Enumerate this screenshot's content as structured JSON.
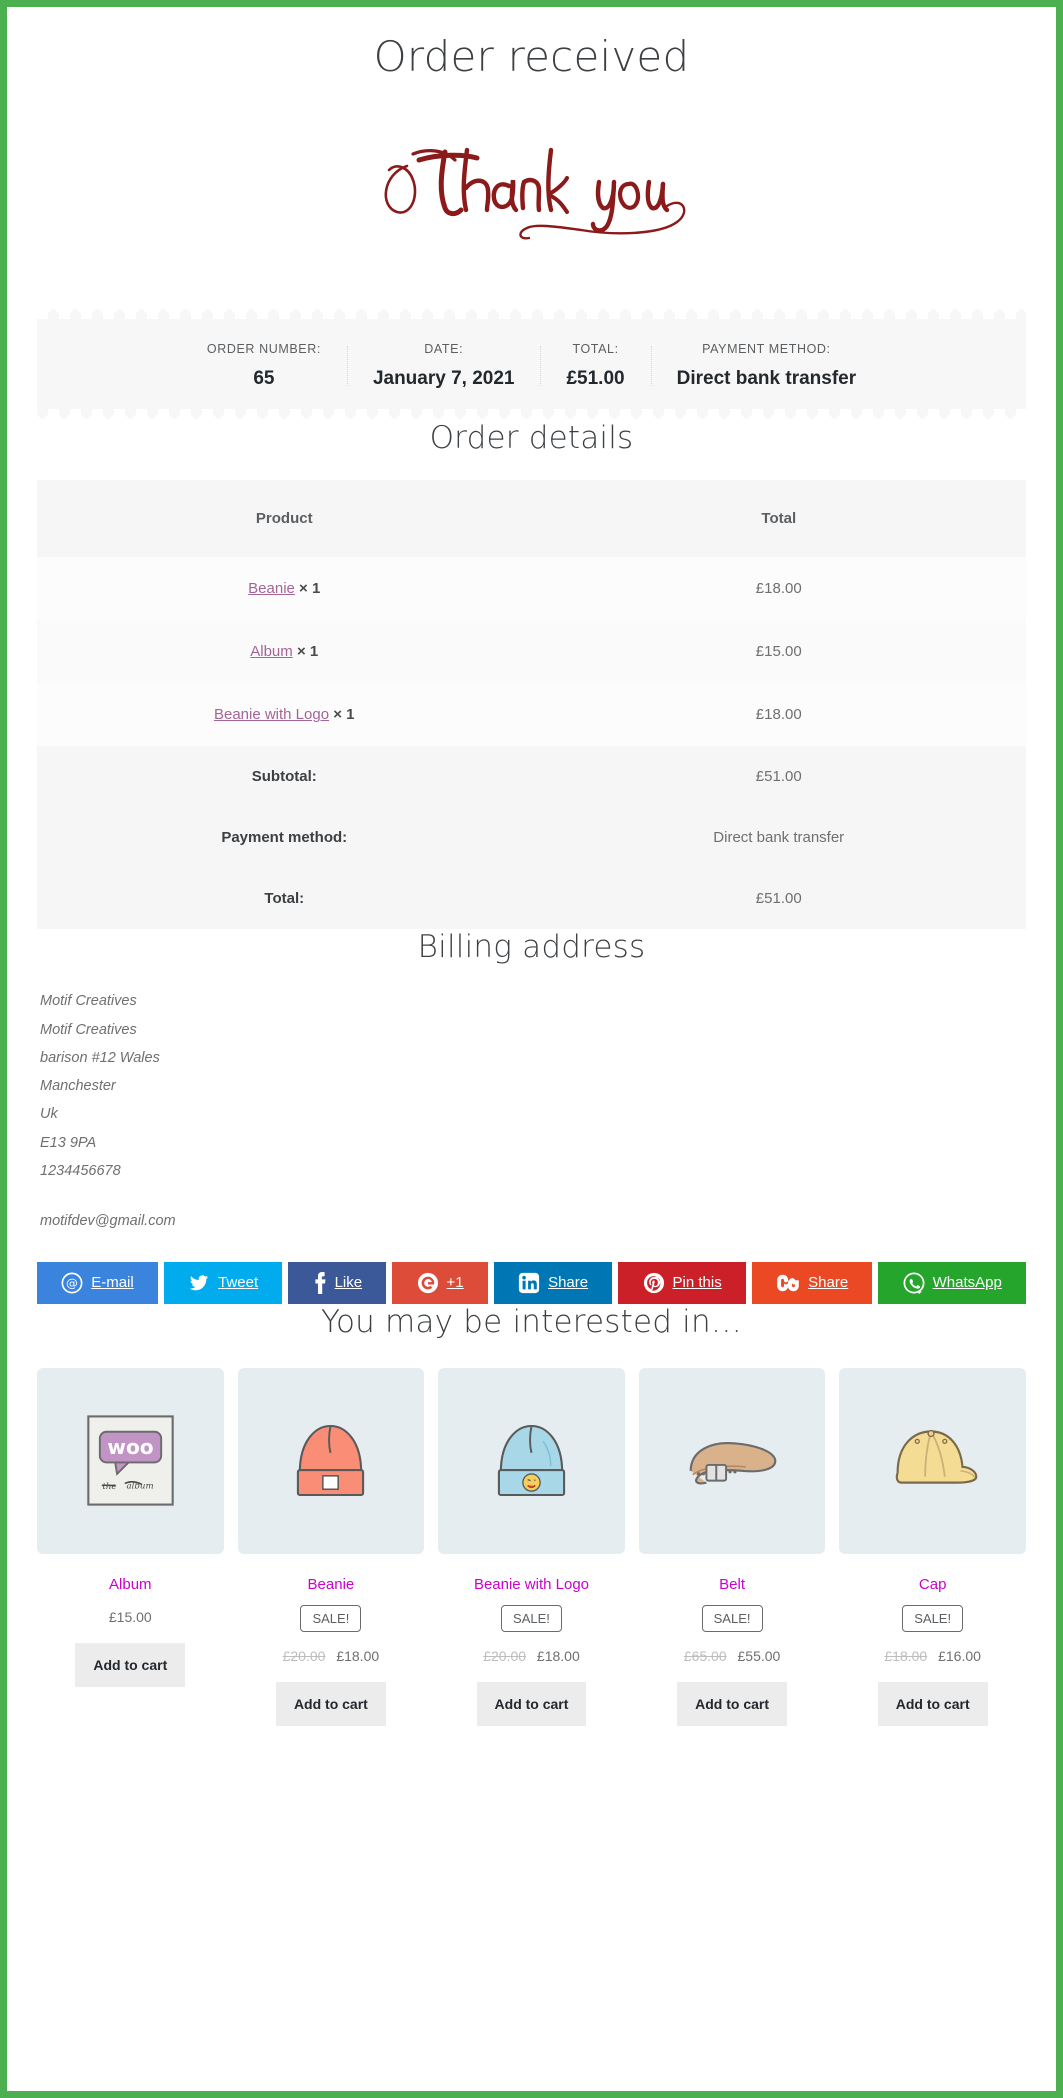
{
  "theme": {
    "admin_bar_color": "#4cb050",
    "link_color": "#a46497",
    "product_link_color": "#cc01cc",
    "script_color": "#8b1a1a"
  },
  "header": {
    "page_title": "Order received",
    "thank_you_script": "Thank you"
  },
  "receipt": {
    "cells": [
      {
        "label": "ORDER NUMBER:",
        "value": "65"
      },
      {
        "label": "DATE:",
        "value": "January 7, 2021"
      },
      {
        "label": "TOTAL:",
        "value": "£51.00"
      },
      {
        "label": "PAYMENT METHOD:",
        "value": "Direct bank transfer"
      }
    ]
  },
  "order_details": {
    "heading": "Order details",
    "columns": [
      "Product",
      "Total"
    ],
    "items": [
      {
        "name": "Beanie",
        "qty": "× 1",
        "total": "£18.00"
      },
      {
        "name": "Album",
        "qty": "× 1",
        "total": "£15.00"
      },
      {
        "name": "Beanie with Logo",
        "qty": "× 1",
        "total": "£18.00"
      }
    ],
    "footer": [
      {
        "label": "Subtotal:",
        "value": "£51.00"
      },
      {
        "label": "Payment method:",
        "value": "Direct bank transfer"
      },
      {
        "label": "Total:",
        "value": "£51.00"
      }
    ]
  },
  "billing": {
    "heading": "Billing address",
    "lines": [
      "Motif Creatives",
      "Motif Creatives",
      "barison #12 Wales",
      "Manchester",
      "Uk",
      "E13 9PA",
      "1234456678"
    ],
    "email": "motifdev@gmail.com"
  },
  "share": {
    "buttons": [
      {
        "icon": "email-icon",
        "label": "E-mail",
        "color": "#3a84dd"
      },
      {
        "icon": "twitter-icon",
        "label": "Tweet",
        "color": "#00aced"
      },
      {
        "icon": "facebook-icon",
        "label": "Like",
        "color": "#3b5998"
      },
      {
        "icon": "google-plus-icon",
        "label": "+1",
        "color": "#dd4b39"
      },
      {
        "icon": "linkedin-icon",
        "label": "Share",
        "color": "#0077b5"
      },
      {
        "icon": "pinterest-icon",
        "label": "Pin this",
        "color": "#cb2027"
      },
      {
        "icon": "stumbleupon-icon",
        "label": "Share",
        "color": "#eb4924"
      },
      {
        "icon": "whatsapp-icon",
        "label": "WhatsApp",
        "color": "#25a52c"
      }
    ]
  },
  "related": {
    "heading": "You may be interested in…",
    "add_to_cart_label": "Add to cart",
    "sale_label": "SALE!",
    "products": [
      {
        "name": "Album",
        "image": "album-thumb",
        "on_sale": false,
        "old_price": "",
        "price": "£15.00"
      },
      {
        "name": "Beanie",
        "image": "beanie-thumb",
        "on_sale": true,
        "old_price": "£20.00",
        "price": "£18.00"
      },
      {
        "name": "Beanie with Logo",
        "image": "beanie-with-logo-thumb",
        "on_sale": true,
        "old_price": "£20.00",
        "price": "£18.00"
      },
      {
        "name": "Belt",
        "image": "belt-thumb",
        "on_sale": true,
        "old_price": "£65.00",
        "price": "£55.00"
      },
      {
        "name": "Cap",
        "image": "cap-thumb",
        "on_sale": true,
        "old_price": "£18.00",
        "price": "£16.00"
      }
    ]
  }
}
